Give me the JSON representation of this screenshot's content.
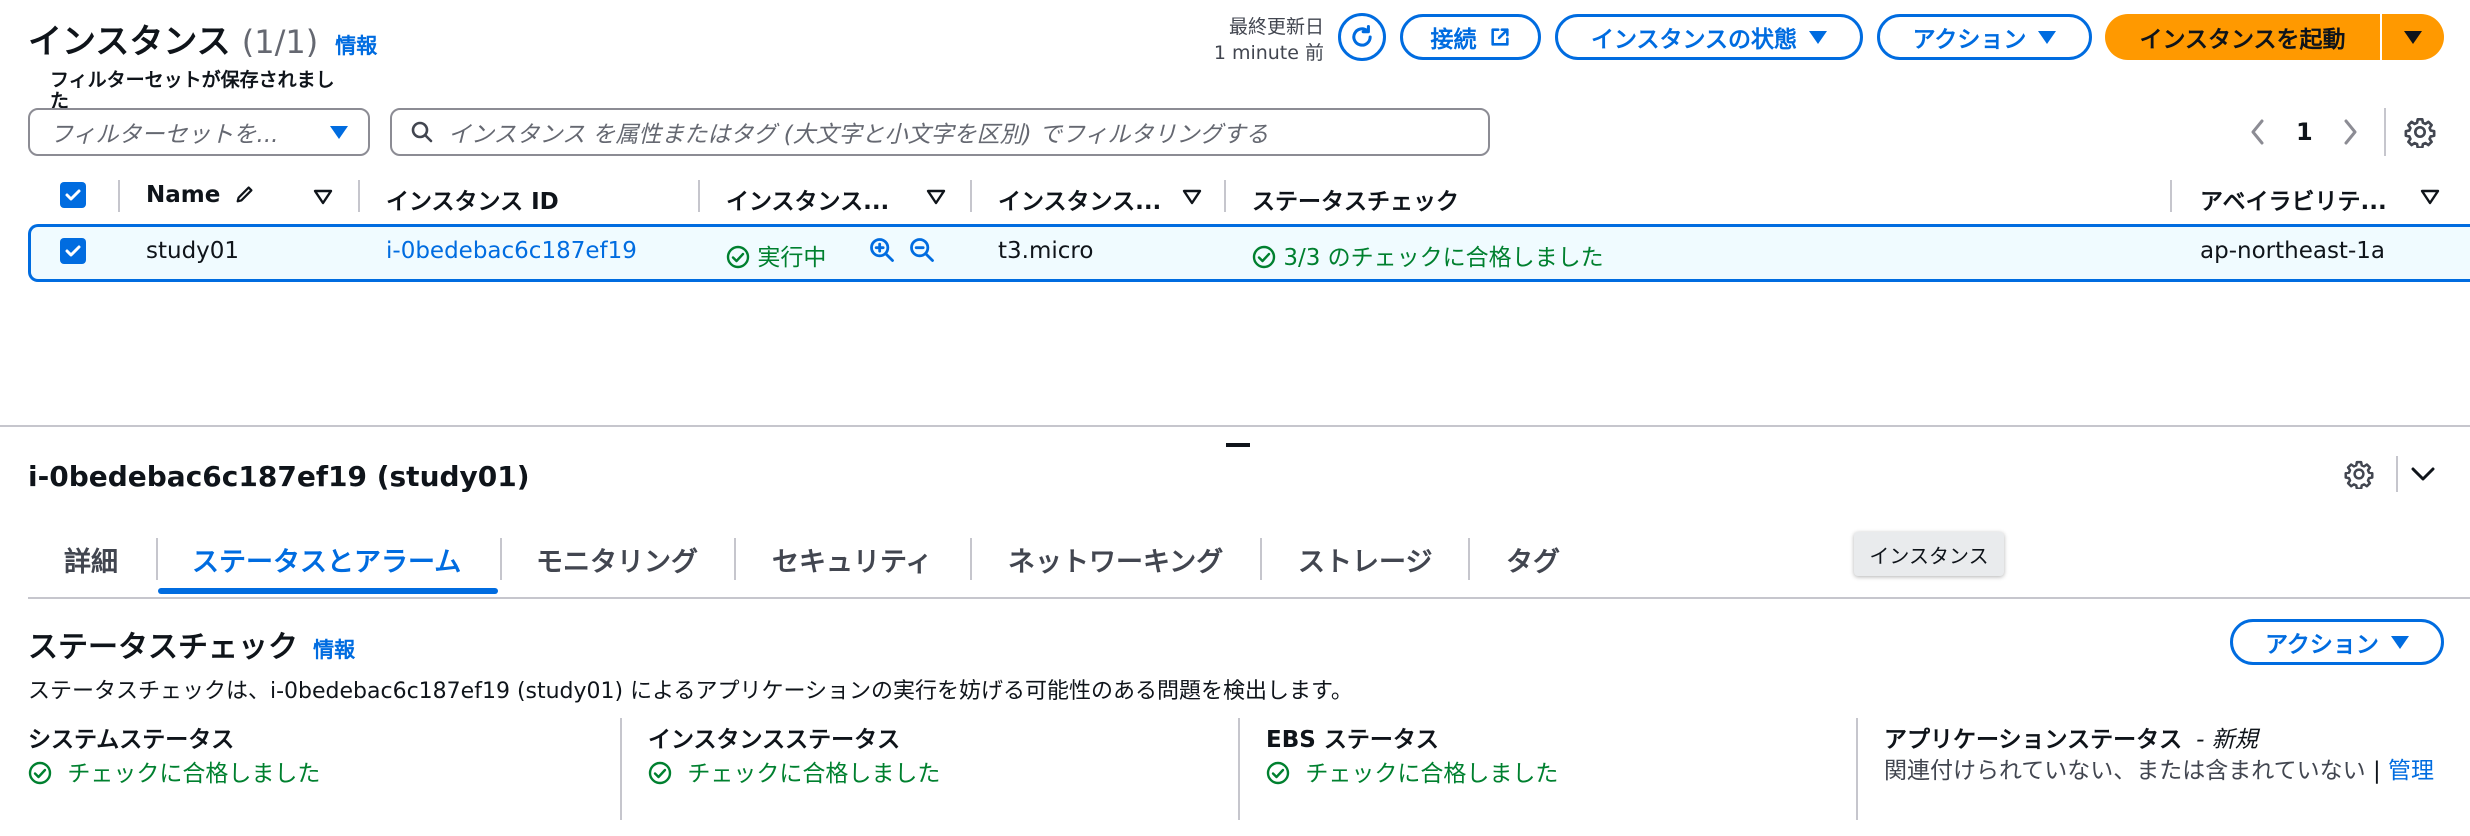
{
  "header": {
    "title": "インスタンス",
    "count": "(1/1)",
    "info_link": "情報",
    "last_updated_label": "最終更新日",
    "last_updated_value": "1 minute 前",
    "connect_label": "接続",
    "instance_state_label": "インスタンスの状態",
    "actions_label": "アクション",
    "launch_label": "インスタンスを起動"
  },
  "filters": {
    "saved_set_label": "フィルターセットが保存されました",
    "saved_set_placeholder": "フィルターセットを...",
    "search_placeholder": "インスタンス を属性またはタグ (大文字と小文字を区別) でフィルタリングする"
  },
  "pagination": {
    "current_page": "1"
  },
  "table": {
    "columns": [
      "Name",
      "インスタンス ID",
      "インスタンス...",
      "インスタンス...",
      "ステータスチェック",
      "アベイラビリテ..."
    ],
    "rows": [
      {
        "name": "study01",
        "instance_id": "i-0bedebac6c187ef19",
        "state": "実行中",
        "type": "t3.micro",
        "status_check": "3/3 のチェックに合格しました",
        "az": "ap-northeast-1a"
      }
    ]
  },
  "details": {
    "title": "i-0bedebac6c187ef19 (study01)",
    "tabs": [
      "詳細",
      "ステータスとアラーム",
      "モニタリング",
      "セキュリティ",
      "ネットワーキング",
      "ストレージ",
      "タグ"
    ],
    "active_tab": "ステータスとアラーム",
    "tooltip": "インスタンス",
    "status_check": {
      "title": "ステータスチェック",
      "info_link": "情報",
      "actions_label": "アクション",
      "description": "ステータスチェックは、i-0bedebac6c187ef19 (study01) によるアプリケーションの実行を妨げる可能性のある問題を検出します。",
      "system_status_label": "システムステータス",
      "system_status_value": "チェックに合格しました",
      "instance_status_label": "インスタンスステータス",
      "instance_status_value": "チェックに合格しました",
      "ebs_status_label": "EBS ステータス",
      "ebs_status_value": "チェックに合格しました",
      "app_status_label": "アプリケーションステータス",
      "app_status_new": "- 新規",
      "app_status_value": "関連付けられていない、または含まれていない",
      "app_status_link": "管理"
    }
  },
  "colors": {
    "accent_blue": "#006ce0",
    "success_green": "#00802f",
    "launch_orange": "#ff9900",
    "selected_row_bg": "#f0fbff"
  }
}
